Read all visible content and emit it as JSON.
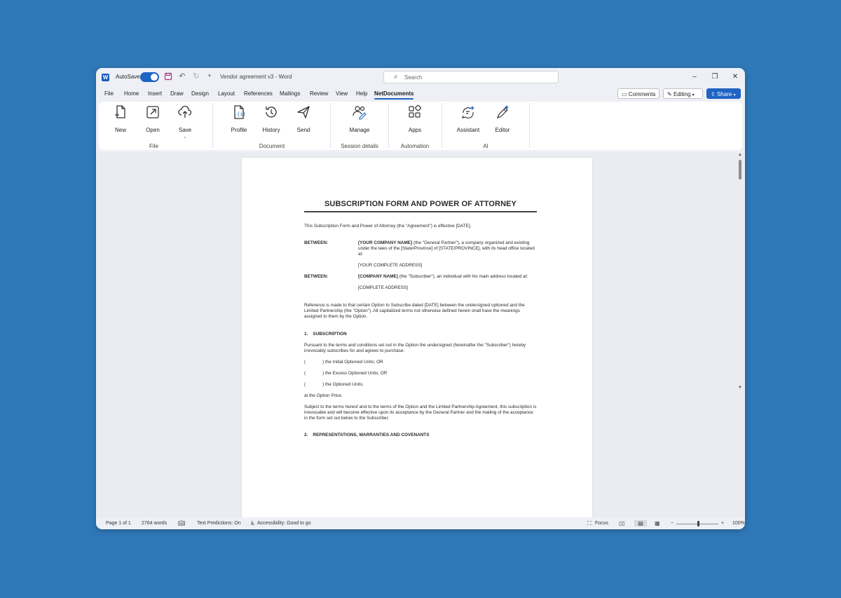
{
  "titlebar": {
    "autosave_label": "AutoSave",
    "doc_title": "Vendor agreement v3 - Word",
    "search_placeholder": "Search"
  },
  "menu": {
    "tabs": [
      "File",
      "Home",
      "Insert",
      "Draw",
      "Design",
      "Layout",
      "References",
      "Mailings",
      "Review",
      "View",
      "Help",
      "NetDocuments"
    ],
    "active": "NetDocuments",
    "comments_label": "Comments",
    "editing_label": "Editing",
    "share_label": "Share"
  },
  "ribbon": {
    "buttons": {
      "new": "New",
      "open": "Open",
      "save": "Save",
      "profile": "Profile",
      "history": "History",
      "send": "Send",
      "manage": "Manage",
      "apps": "Apps",
      "assistant": "Assistant",
      "editor": "Editor"
    },
    "groups": {
      "file": "File",
      "document": "Document",
      "session": "Session details",
      "automation": "Automation",
      "ai": "AI"
    }
  },
  "document": {
    "title": "SUBSCRIPTION FORM AND POWER OF ATTORNEY",
    "intro": "This Subscription Form and Power of Attorney (the \"Agreement\") is effective [DATE],",
    "between1_key": "BETWEEN:",
    "between1_name": "[YOUR COMPANY NAME]",
    "between1_text": " (the \"General Partner\"), a company organized and existing under the laws of the [State/Province] of [STATE/PROVINCE], with its head office located at:",
    "between1_address": "[YOUR COMPLETE ADDRESS]",
    "between2_key": "BETWEEN:",
    "between2_name": "[COMPANY NAME]",
    "between2_text": " (the \"Subscriber\"), an individual with his main address located at:",
    "between2_address": "[COMPLETE ADDRESS]",
    "reference": "Reference is made to that certain Option to Subscribe dated [DATE] between the undersigned optioned and the Limited Partnership (the \"Option\"). All capitalized terms not otherwise defined herein shall have the meanings assigned to them by the Option.",
    "section1": "1.    SUBSCRIPTION",
    "section1_text": "Pursuant to the terms and conditions set out in the Option the undersigned (hereinafter the \"Subscriber\") hereby irrevocably subscribes for and agrees to purchase:",
    "paren": "(",
    "opt1": ") the Initial Optioned Units; OR",
    "opt2": ") the Excess Optioned Units; OR",
    "opt3": ") the Optioned Units;",
    "price": "at the Option Price.",
    "subject": "Subject to the terms hereof and to the terms of the Option and the Limited Partnership Agreement, this subscription is irrevocable and will become effective upon its acceptance by the General Partner and the mailing of the acceptance in the form set out below to the Subscriber.",
    "section2": "2.    REPRESENTATIONS, WARRANTIES AND COVENANTS"
  },
  "status": {
    "page": "Page 1 of 1",
    "words": "2764 words",
    "predictions": "Text Predictions: On",
    "accessibility": "Accessibility: Good to go",
    "focus": "Focus",
    "zoom": "100%"
  },
  "colors": {
    "background": "#2f78b7",
    "accent": "#1f64c4"
  }
}
